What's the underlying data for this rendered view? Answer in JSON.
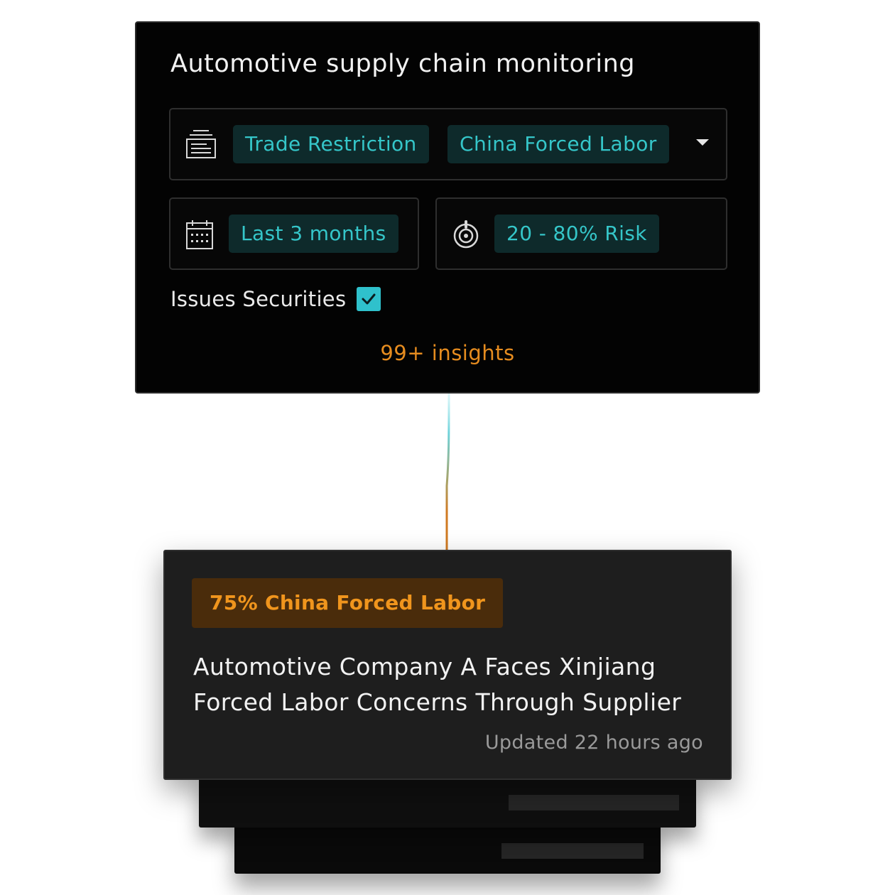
{
  "panel": {
    "title": "Automotive supply chain monitoring",
    "category_filter": {
      "icon": "newspaper-icon",
      "chips": [
        "Trade Restriction",
        "China Forced Labor"
      ],
      "dropdown_icon": "caret-down-icon"
    },
    "date_filter": {
      "icon": "calendar-icon",
      "value": "Last 3 months"
    },
    "risk_filter": {
      "icon": "risk-dial-icon",
      "value": "20 - 80% Risk"
    },
    "issues_securities": {
      "label": "Issues Securities",
      "checked": true
    },
    "insights_count": "99+ insights"
  },
  "insight_card": {
    "risk_badge": "75% China Forced Labor",
    "title": "Automotive Company A Faces Xinjiang Forced Labor Concerns Through Supplier",
    "updated": "Updated 22 hours ago"
  },
  "colors": {
    "accent_teal": "#35c6c9",
    "chip_bg": "#0e2a2b",
    "accent_orange": "#e68c1f",
    "badge_bg": "#4a2c0b",
    "panel_bg": "#030303",
    "card_bg": "#1e1e1e"
  }
}
